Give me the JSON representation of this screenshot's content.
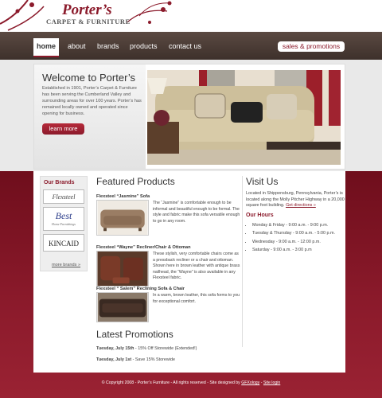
{
  "logo": {
    "title": "Porter’s",
    "subtitle": "CARPET & FURNITURE"
  },
  "nav": {
    "home": "home",
    "about": "about",
    "brands": "brands",
    "products": "products",
    "contact": "contact us",
    "sales": "sales & promotions"
  },
  "hero": {
    "title": "Welcome to Porter’s",
    "text": "Established in 1901, Porter’s Carpet & Furniture has been serving the Cumberland Valley and surrounding areas for over 100 years. Porter’s has remained locally owned and operated since opening for business.",
    "button": "learn more"
  },
  "brands": {
    "title": "Our Brands",
    "items": [
      "Flexsteel",
      "Best",
      "KINCAID"
    ],
    "best_sub": "Home Furnishings",
    "more": "more brands »"
  },
  "featured": {
    "title": "Featured Products",
    "products": [
      {
        "name": "Flexsteel “Jasmine” Sofa",
        "desc": "The “Jasmine” is comfortable enough to be informal and beautiful enough to be formal. The style and fabric make this sofa versatile enough to go in any room."
      },
      {
        "name": "Flexsteel “Wayne” Recliner/Chair & Ottoman",
        "desc": "These stylish, very comfortable chairs come as a pressback recliner or a chair and ottoman. Shown here in brown leather with antique brass nailhead, the “Wayne” is also available in any Flexsteel fabric."
      },
      {
        "name": "Flexsteel “ Salem” Reclining Sofa & Chair",
        "desc": "In a warm, brown leather, this sofa forms to you for exceptional comfort."
      }
    ]
  },
  "visit": {
    "title": "Visit Us",
    "text": "Located in Shippensburg, Pennsylvania, Porter’s is located along the Molly Pitcher Highway in a 20,000 square foot building.",
    "directions": "Get directions »",
    "hours_title": "Our Hours",
    "hours": [
      "Monday & Friday - 9:00 a.m. - 9:00 p.m.",
      "Tuesday & Thursday - 9:00 a.m. - 5:00 p.m.",
      "Wednesday - 9:00 a.m. - 12:00 p.m.",
      "Saturday - 9:00 a.m. - 3:00 p.m"
    ]
  },
  "promos": {
    "title": "Latest Promotions",
    "items": [
      {
        "date": "Tuesday, July 15th",
        "text": " - 15% Off Storewide (Extended!)"
      },
      {
        "date": "Tuesday, July 1st",
        "text": " - Save 15% Storewide"
      }
    ]
  },
  "footer": {
    "text": "© Copyright 2008 - Porter’s Furniture - All rights reserved - Site designed by ",
    "designer": "GFXology",
    "sep": " - ",
    "login": "Site login"
  },
  "colors": {
    "accent": "#8b1a2b",
    "nav": "#4a3a33",
    "bg_bottom": "#8b1a2b"
  }
}
